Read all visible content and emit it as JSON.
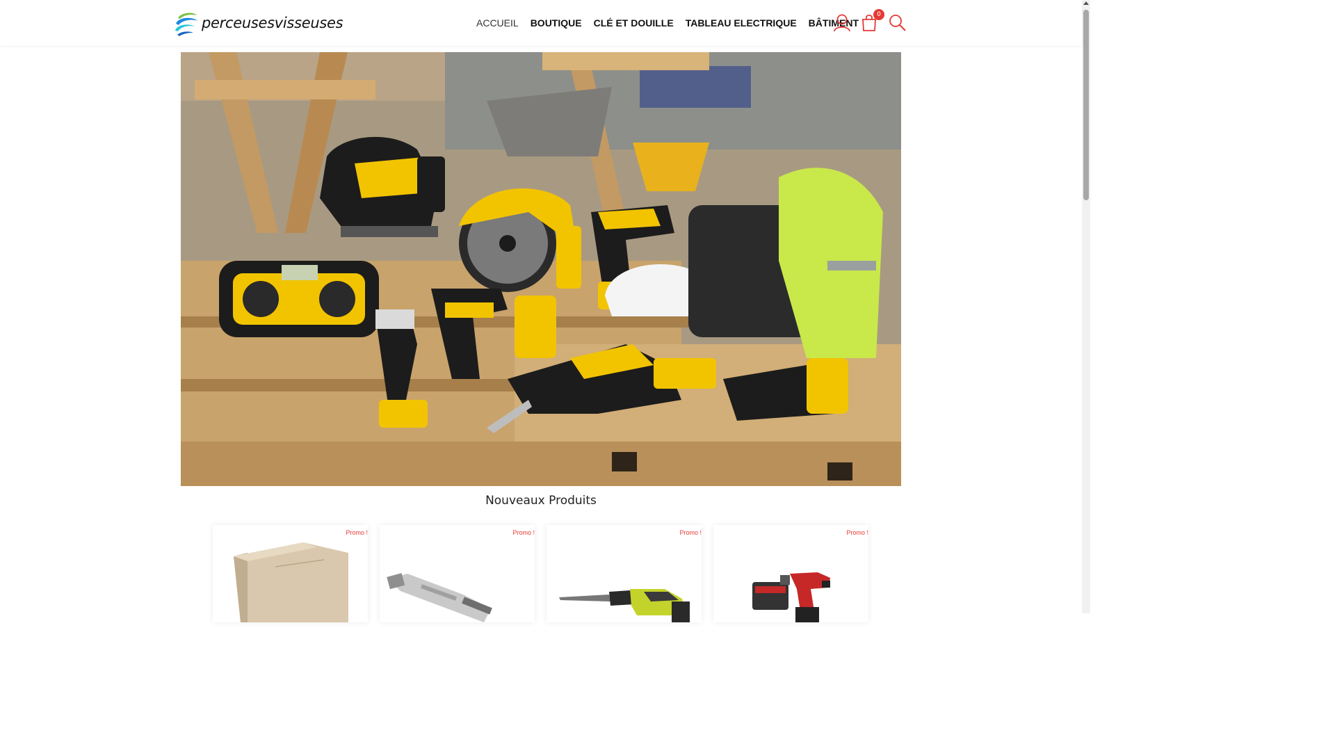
{
  "brand": {
    "name": "perceusesvisseuses"
  },
  "nav": {
    "items": [
      {
        "label": "ACCUEIL",
        "active": true
      },
      {
        "label": "BOUTIQUE",
        "active": false
      },
      {
        "label": "CLÉ ET DOUILLE",
        "active": false
      },
      {
        "label": "TABLEAU ELECTRIQUE",
        "active": false
      },
      {
        "label": "BÂTIMENT",
        "active": false
      }
    ]
  },
  "header_icons": {
    "account": "user-icon",
    "cart": "shopping-bag-icon",
    "cart_count": "0",
    "search": "search-icon"
  },
  "hero": {
    "image": "hero-power-tools-image"
  },
  "section": {
    "title": "Nouveaux Produits"
  },
  "products": [
    {
      "badge": "Promo !",
      "image": "product-box-image"
    },
    {
      "badge": "Promo !",
      "image": "product-bit-holder-image"
    },
    {
      "badge": "Promo !",
      "image": "product-reciprocating-saw-image"
    },
    {
      "badge": "Promo !",
      "image": "product-drill-kit-image"
    }
  ],
  "colors": {
    "accent": "#e53935",
    "tool_yellow": "#f2c400",
    "tool_black": "#1c1c1c",
    "wood": "#c8a46e"
  }
}
